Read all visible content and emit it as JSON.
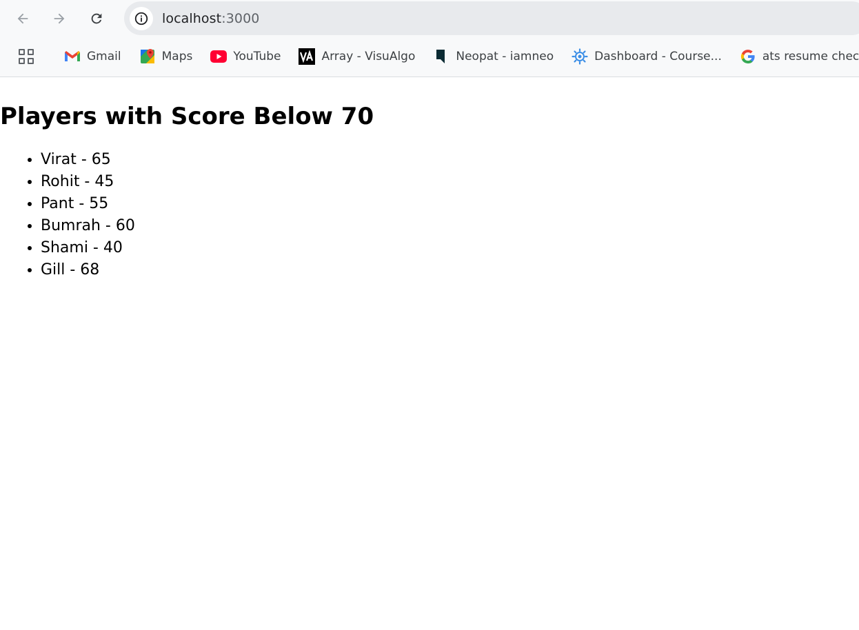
{
  "browser": {
    "url_host": "localhost",
    "url_port": ":3000",
    "bookmarks": [
      {
        "label": "Gmail",
        "icon": "gmail-icon"
      },
      {
        "label": "Maps",
        "icon": "maps-icon"
      },
      {
        "label": "YouTube",
        "icon": "youtube-icon"
      },
      {
        "label": "Array - VisuAlgo",
        "icon": "visualgo-icon"
      },
      {
        "label": "Neopat - iamneo",
        "icon": "neopat-icon"
      },
      {
        "label": "Dashboard - Course...",
        "icon": "dashboard-gear-icon"
      },
      {
        "label": "ats resume checker...",
        "icon": "google-icon"
      }
    ]
  },
  "page": {
    "heading": "Players with Score Below 70",
    "players": [
      "Virat - 65",
      "Rohit - 45",
      "Pant - 55",
      "Bumrah - 60",
      "Shami - 40",
      "Gill - 68"
    ]
  },
  "colors": {
    "chrome_bg": "#f8f9fa",
    "omnibox_bg": "#e8eaed",
    "text": "#000000"
  }
}
